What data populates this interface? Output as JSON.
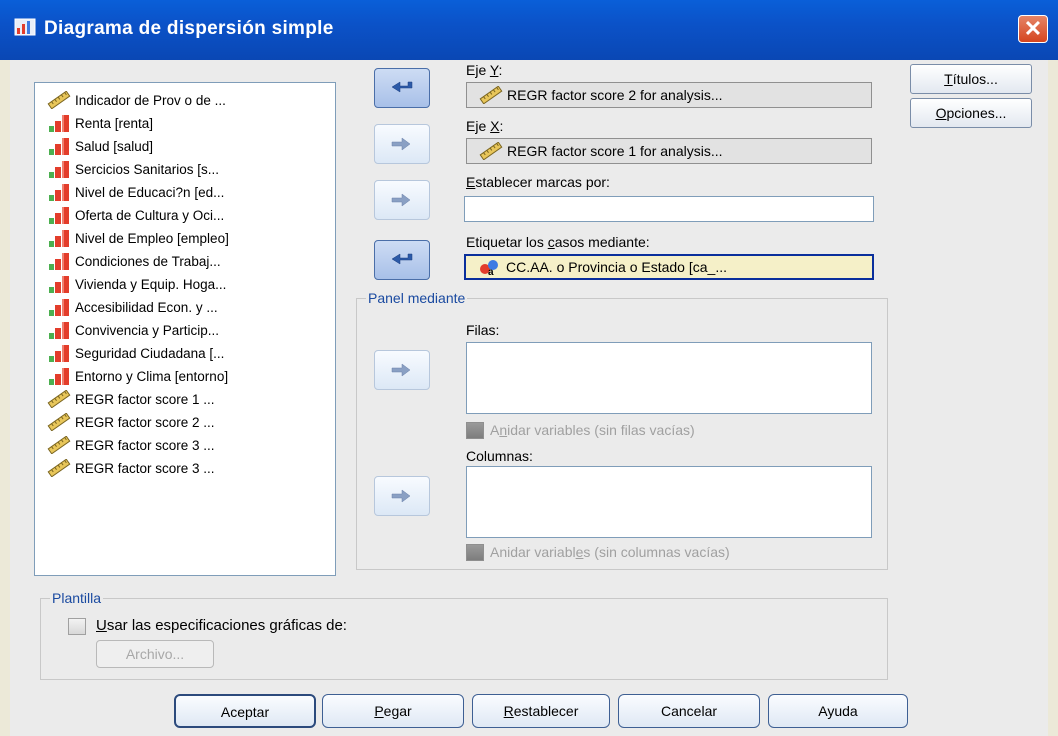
{
  "window": {
    "title": "Diagrama de dispersión simple",
    "close_glyph": "✕"
  },
  "variables": [
    {
      "label": "Indicador de Prov o de ...",
      "icon": "string-ruler-icon"
    },
    {
      "label": "Renta [renta]",
      "icon": "ordinal-bar-icon"
    },
    {
      "label": "Salud [salud]",
      "icon": "ordinal-bar-icon"
    },
    {
      "label": "Sercicios Sanitarios [s...",
      "icon": "ordinal-bar-icon"
    },
    {
      "label": "Nivel de Educaci?n [ed...",
      "icon": "ordinal-bar-icon"
    },
    {
      "label": "Oferta de Cultura y Oci...",
      "icon": "ordinal-bar-icon"
    },
    {
      "label": "Nivel de Empleo [empleo]",
      "icon": "ordinal-bar-icon"
    },
    {
      "label": "Condiciones de Trabaj...",
      "icon": "ordinal-bar-icon"
    },
    {
      "label": "Vivienda y Equip. Hoga...",
      "icon": "ordinal-bar-icon"
    },
    {
      "label": "Accesibilidad Econ. y ...",
      "icon": "ordinal-bar-icon"
    },
    {
      "label": "Convivencia y Particip...",
      "icon": "ordinal-bar-icon"
    },
    {
      "label": "Seguridad Ciudadana [...",
      "icon": "ordinal-bar-icon"
    },
    {
      "label": "Entorno y Clima [entorno]",
      "icon": "ordinal-bar-icon"
    },
    {
      "label": "REGR factor score   1 ...",
      "icon": "scale-ruler-icon"
    },
    {
      "label": "REGR factor score   2 ...",
      "icon": "scale-ruler-icon"
    },
    {
      "label": "REGR factor score   3 ...",
      "icon": "scale-ruler-icon"
    },
    {
      "label": "REGR factor score   3 ...",
      "icon": "scale-ruler-icon"
    }
  ],
  "eje_y": {
    "label_prefix": "Eje ",
    "label_key": "Y",
    "label_suffix": ":",
    "value": "REGR factor score   2 for analysis..."
  },
  "eje_x": {
    "label_prefix": "Eje ",
    "label_key": "X",
    "label_suffix": ":",
    "value": "REGR factor score   1 for analysis..."
  },
  "marcas": {
    "label_key": "E",
    "label_rest": "stablecer marcas por:",
    "value": ""
  },
  "etiquetar": {
    "label_pre": "Etiquetar los ",
    "label_key": "c",
    "label_rest": "asos mediante:",
    "value": "CC.AA. o Provincia o Estado [ca_..."
  },
  "panel": {
    "title": "Panel mediante",
    "filas_label": "Filas:",
    "anidar_filas_pre": "A",
    "anidar_filas_key": "n",
    "anidar_filas_rest": "idar variables (sin filas vacías)",
    "columnas_label": "Columnas:",
    "anidar_columnas_pre": "Anidar variabl",
    "anidar_columnas_key": "e",
    "anidar_columnas_rest": "s (sin columnas vacías)"
  },
  "plantilla": {
    "title": "Plantilla",
    "usar_key": "U",
    "usar_rest": "sar las especificaciones gráficas de:",
    "archivo_label": "Archivo..."
  },
  "side_buttons": {
    "titulos_key": "T",
    "titulos_rest": "ítulos...",
    "opciones_key": "O",
    "opciones_rest": "pciones..."
  },
  "bottom_buttons": {
    "aceptar": "Aceptar",
    "pegar_key": "P",
    "pegar_rest": "egar",
    "restablecer_key": "R",
    "restablecer_rest": "establecer",
    "cancelar": "Cancelar",
    "ayuda": "Ayuda"
  },
  "colors": {
    "titlebar": "#0a52c8",
    "close_button": "#d5451f",
    "focused_field_bg": "#f5f0c8"
  }
}
